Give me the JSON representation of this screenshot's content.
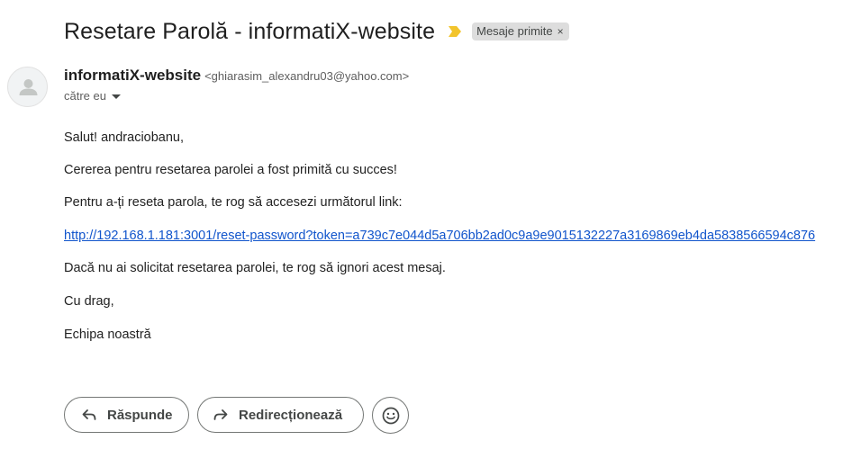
{
  "subject": "Resetare Parolă - informatiX-website",
  "label_chip": {
    "label": "Mesaje primite",
    "close": "×"
  },
  "sender": {
    "name": "informatiX-website",
    "email": "<ghiarasim_alexandru03@yahoo.com>",
    "to": "către eu"
  },
  "body": {
    "greeting": "Salut! andraciobanu,",
    "line1": "Cererea pentru resetarea parolei a fost primită cu succes!",
    "line2": "Pentru a-ți reseta parola, te rog să accesezi următorul link:",
    "link": "http://192.168.1.181:3001/reset-password?token=a739c7e044d5a706bb2ad0c9a9e9015132227a3169869eb4da5838566594c876",
    "line3": "Dacă nu ai solicitat resetarea parolei, te rog să ignori acest mesaj.",
    "closing": "Cu drag,",
    "signature": "Echipa noastră"
  },
  "actions": {
    "reply": "Răspunde",
    "forward": "Redirecționează"
  },
  "colors": {
    "importance_marker": "#f2c42c",
    "link": "#1155cc",
    "chip_bg": "#dddddd"
  },
  "icons": {
    "importance": "importance-marker-icon",
    "avatar": "default-avatar-icon",
    "reply": "reply-arrow-icon",
    "forward": "forward-arrow-icon",
    "emoji": "smiley-emoji-icon"
  }
}
